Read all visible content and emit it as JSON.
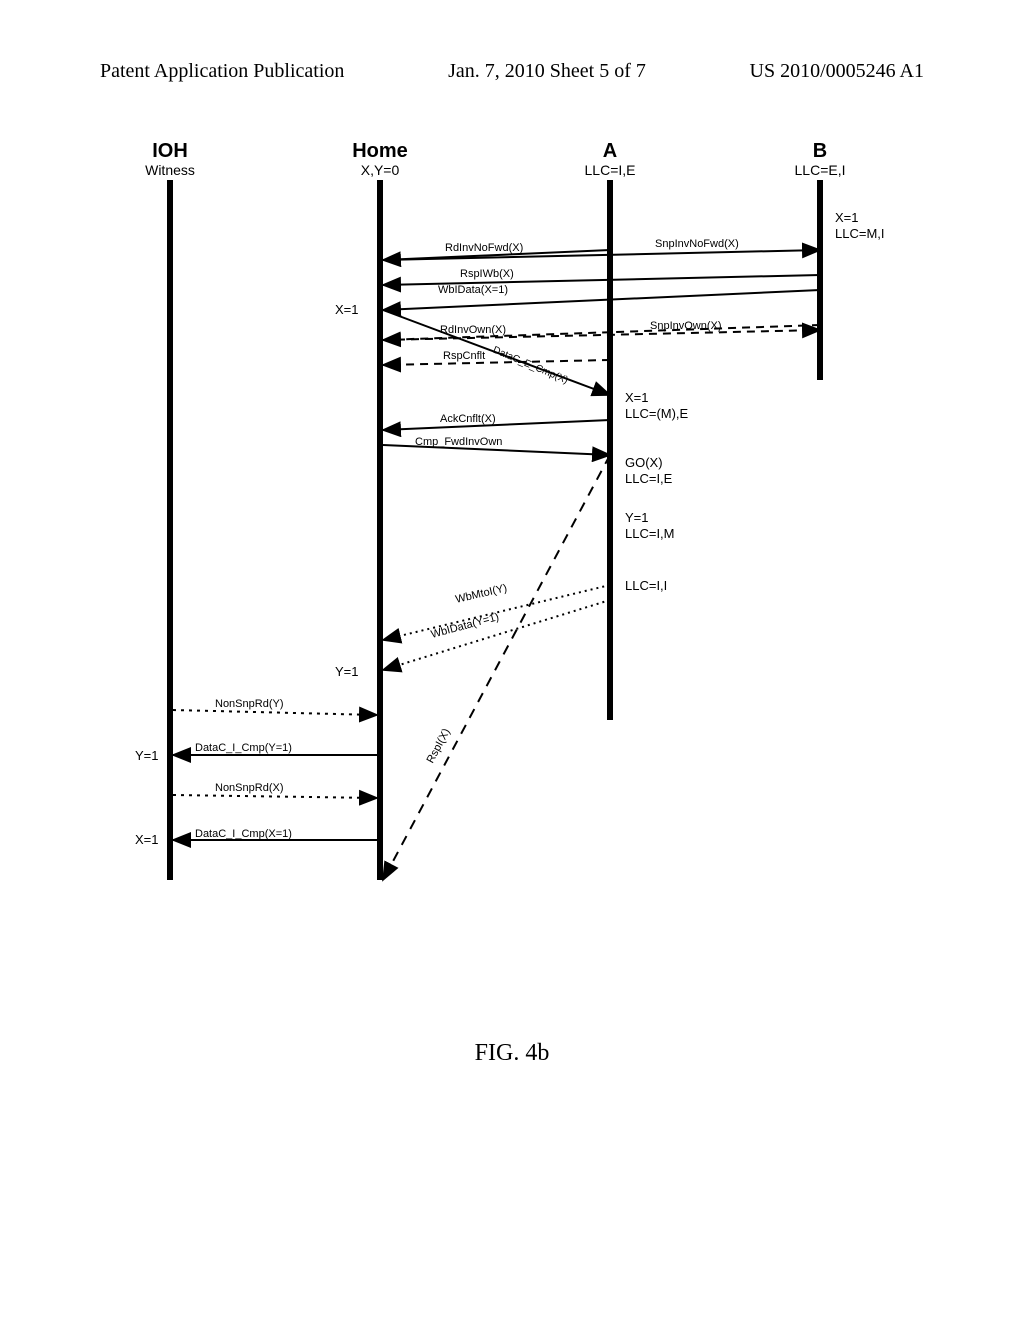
{
  "header": {
    "left": "Patent Application Publication",
    "center": "Jan. 7, 2010   Sheet 5 of 7",
    "right": "US 2010/0005246 A1"
  },
  "lifelines": {
    "ioh": {
      "title": "IOH",
      "sub": "Witness"
    },
    "home": {
      "title": "Home",
      "sub": "X,Y=0"
    },
    "a": {
      "title": "A",
      "sub": "LLC=I,E"
    },
    "b": {
      "title": "B",
      "sub": "LLC=E,I"
    }
  },
  "messages": {
    "m1": "RdInvNoFwd(X)",
    "m2": "SnpInvNoFwd(X)",
    "m3": "RspIWb(X)",
    "m4": "WbIData(X=1)",
    "m5": "RdInvOwn(X)",
    "m6": "SnpInvOwn(X)",
    "m7": "RspCnflt",
    "m8": "DataC_E_Cmp(X)",
    "m9": "AckCnflt(X)",
    "m10": "Cmp_FwdInvOwn",
    "m11": "WbMtoI(Y)",
    "m12": "WbIData(Y=1)",
    "m13": "RspI(X)",
    "m14": "NonSnpRd(Y)",
    "m15": "DataC_I_Cmp(Y=1)",
    "m16": "NonSnpRd(X)",
    "m17": "DataC_I_Cmp(X=1)"
  },
  "states": {
    "s1a": "X=1",
    "s1b": "LLC=M,I",
    "s2": "X=1",
    "s3a": "X=1",
    "s3b": "LLC=(M),E",
    "s4a": "GO(X)",
    "s4b": "LLC=I,E",
    "s5a": "Y=1",
    "s5b": "LLC=I,M",
    "s6": "LLC=I,I",
    "s7": "Y=1",
    "s8": "Y=1",
    "s9": "X=1"
  },
  "caption": "FIG. 4b"
}
